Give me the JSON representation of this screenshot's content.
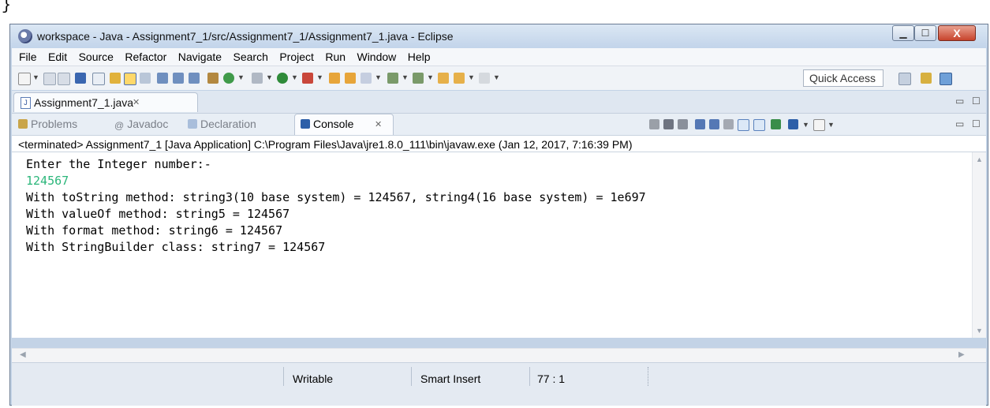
{
  "page": {
    "brace": "}"
  },
  "window": {
    "title": "workspace - Java - Assignment7_1/src/Assignment7_1/Assignment7_1.java - Eclipse",
    "minimize_symbol": "▁",
    "maximize_symbol": "☐",
    "close_symbol": "X"
  },
  "menu": {
    "items": [
      "File",
      "Edit",
      "Source",
      "Refactor",
      "Navigate",
      "Search",
      "Project",
      "Run",
      "Window",
      "Help"
    ]
  },
  "toolbar": {
    "quick_access": "Quick Access"
  },
  "editor": {
    "tab_label": "Assignment7_1.java",
    "tab_close": "✕",
    "minimize_symbol": "▭",
    "maximize_symbol": "☐"
  },
  "views": {
    "tabs": [
      {
        "label": "Problems",
        "icon": "problems-icon",
        "active": false
      },
      {
        "label": "Javadoc",
        "icon": "javadoc-icon",
        "active": false
      },
      {
        "label": "Declaration",
        "icon": "declaration-icon",
        "active": false
      },
      {
        "label": "Console",
        "icon": "console-icon",
        "active": true
      }
    ],
    "console_close": "✕",
    "minimize_symbol": "▭",
    "maximize_symbol": "☐"
  },
  "console": {
    "status": "<terminated> Assignment7_1 [Java Application] C:\\Program Files\\Java\\jre1.8.0_111\\bin\\javaw.exe (Jan 12, 2017, 7:16:39 PM)",
    "lines": [
      {
        "text": "Enter the Integer number:-",
        "kind": "output"
      },
      {
        "text": "124567",
        "kind": "input"
      },
      {
        "text": "With toString method: string3(10 base system) = 124567, string4(16 base system) = 1e697",
        "kind": "output"
      },
      {
        "text": "With valueOf method: string5 = 124567",
        "kind": "output"
      },
      {
        "text": "With format method: string6 = 124567",
        "kind": "output"
      },
      {
        "text": "With StringBuilder class: string7 = 124567",
        "kind": "output"
      }
    ],
    "input_color": "#2bb67a"
  },
  "statusbar": {
    "writable": "Writable",
    "insert_mode": "Smart Insert",
    "position": "77 : 1"
  }
}
